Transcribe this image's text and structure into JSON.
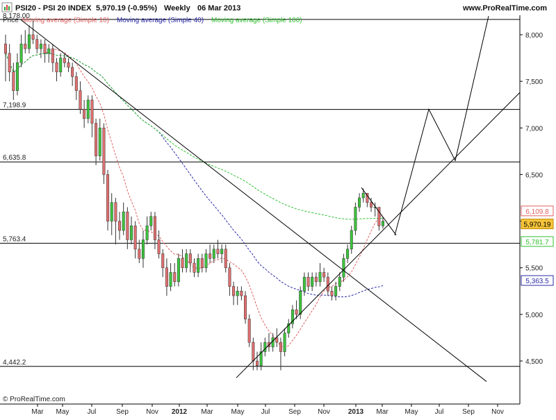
{
  "header": {
    "title": "PSI20 - PSI 20 INDEX",
    "quote": "5,970.19 (-0.95%)",
    "period": "Weekly",
    "date": "06 Mar 2013",
    "site": "www.ProRealTime.com"
  },
  "legend": {
    "price": "Price",
    "ma10": "Moving average (Simple 10)",
    "ma40": "Moving average (Simple 40)",
    "ma100": "Moving average (Simple 100)"
  },
  "copyright": "© ProRealTime.com",
  "colors": {
    "up": "#3cc43c",
    "down": "#e07070",
    "ma10": "#e06060",
    "ma40": "#2a2aa8",
    "ma100": "#30c030",
    "line": "#000000"
  },
  "chart_data": {
    "type": "candlestick",
    "x_ticks": [
      "Mar",
      "May",
      "Jul",
      "Sep",
      "Nov",
      "2012",
      "Mar",
      "May",
      "Jul",
      "Sep",
      "Nov",
      "2013",
      "Mar",
      "May",
      "Jul",
      "Sep",
      "Nov"
    ],
    "y_ticks": [
      "8,000",
      "7,500",
      "7,000",
      "6,500",
      "6,000",
      "5,500",
      "5,000",
      "4,500"
    ],
    "y_tick_values": [
      8000,
      7500,
      7000,
      6500,
      6000,
      5500,
      5000,
      4500
    ],
    "ylim": [
      4300,
      8200
    ],
    "horizontal_levels": [
      {
        "label": "7,198.9",
        "value": 7198.9
      },
      {
        "label": "6,635.8",
        "value": 6635.8
      },
      {
        "label": "5,763.4",
        "value": 5763.4
      },
      {
        "label": "4,442.2",
        "value": 4442.2
      }
    ],
    "top_level_label": "8,178.00",
    "price_tags": [
      {
        "label": "6,109.8",
        "value": 6109.8,
        "series": "ma10"
      },
      {
        "label": "5,970.19",
        "value": 5970.19,
        "series": "price"
      },
      {
        "label": "5,781.7",
        "value": 5781.7,
        "series": "ma100"
      },
      {
        "label": "5,363.5",
        "value": 5363.5,
        "series": "ma40"
      }
    ],
    "candles": [
      [
        7900,
        7800,
        8000,
        7500
      ],
      [
        7800,
        7600,
        7900,
        7500
      ],
      [
        7600,
        7400,
        7700,
        7300
      ],
      [
        7400,
        7700,
        7800,
        7350
      ],
      [
        7700,
        7900,
        8000,
        7650
      ],
      [
        7900,
        7850,
        8050,
        7800
      ],
      [
        7850,
        8000,
        8100,
        7800
      ],
      [
        8000,
        7950,
        8150,
        7900
      ],
      [
        7950,
        7850,
        8000,
        7800
      ],
      [
        7850,
        7900,
        7950,
        7750
      ],
      [
        7900,
        7800,
        7950,
        7700
      ],
      [
        7800,
        7850,
        7900,
        7700
      ],
      [
        7850,
        7700,
        7900,
        7600
      ],
      [
        7700,
        7600,
        7750,
        7500
      ],
      [
        7600,
        7750,
        7800,
        7550
      ],
      [
        7750,
        7700,
        7800,
        7650
      ],
      [
        7700,
        7650,
        7750,
        7600
      ],
      [
        7650,
        7550,
        7700,
        7450
      ],
      [
        7550,
        7400,
        7600,
        7300
      ],
      [
        7400,
        7200,
        7500,
        7150
      ],
      [
        7200,
        7100,
        7300,
        7000
      ],
      [
        7100,
        7300,
        7350,
        7050
      ],
      [
        7300,
        7050,
        7350,
        6900
      ],
      [
        7050,
        6700,
        7100,
        6600
      ],
      [
        6700,
        7000,
        7100,
        6650
      ],
      [
        7000,
        6500,
        7050,
        6400
      ],
      [
        6500,
        6000,
        6550,
        5900
      ],
      [
        6000,
        6200,
        6300,
        5850
      ],
      [
        6200,
        6000,
        6250,
        5750
      ],
      [
        6000,
        5900,
        6100,
        5800
      ],
      [
        5900,
        6100,
        6200,
        5850
      ],
      [
        6100,
        5800,
        6150,
        5700
      ],
      [
        5800,
        5950,
        6050,
        5750
      ],
      [
        5950,
        5700,
        6000,
        5600
      ],
      [
        5700,
        5600,
        5800,
        5550
      ],
      [
        5600,
        5800,
        5900,
        5500
      ],
      [
        5800,
        5950,
        6050,
        5750
      ],
      [
        5950,
        6050,
        6100,
        5900
      ],
      [
        6050,
        5800,
        6100,
        5700
      ],
      [
        5800,
        5650,
        5900,
        5600
      ],
      [
        5650,
        5500,
        5700,
        5400
      ],
      [
        5500,
        5300,
        5600,
        5200
      ],
      [
        5300,
        5450,
        5550,
        5250
      ],
      [
        5450,
        5350,
        5550,
        5300
      ],
      [
        5350,
        5600,
        5650,
        5300
      ],
      [
        5600,
        5500,
        5700,
        5450
      ],
      [
        5500,
        5650,
        5700,
        5450
      ],
      [
        5650,
        5550,
        5700,
        5450
      ],
      [
        5550,
        5450,
        5600,
        5400
      ],
      [
        5450,
        5600,
        5650,
        5400
      ],
      [
        5600,
        5500,
        5650,
        5450
      ],
      [
        5500,
        5650,
        5700,
        5450
      ],
      [
        5650,
        5600,
        5750,
        5550
      ],
      [
        5600,
        5700,
        5750,
        5550
      ],
      [
        5700,
        5650,
        5800,
        5600
      ],
      [
        5650,
        5700,
        5750,
        5550
      ],
      [
        5700,
        5500,
        5750,
        5450
      ],
      [
        5500,
        5300,
        5550,
        5200
      ],
      [
        5300,
        5200,
        5350,
        5100
      ],
      [
        5200,
        5250,
        5300,
        5100
      ],
      [
        5250,
        5200,
        5300,
        5150
      ],
      [
        5200,
        4950,
        5250,
        4900
      ],
      [
        4950,
        4700,
        5000,
        4650
      ],
      [
        4700,
        4500,
        4750,
        4400
      ],
      [
        4500,
        4450,
        4600,
        4400
      ],
      [
        4450,
        4600,
        4700,
        4400
      ],
      [
        4600,
        4700,
        4750,
        4550
      ],
      [
        4700,
        4650,
        4800,
        4600
      ],
      [
        4650,
        4750,
        4800,
        4600
      ],
      [
        4750,
        4700,
        4850,
        4650
      ],
      [
        4700,
        4600,
        4750,
        4400
      ],
      [
        4600,
        4800,
        4850,
        4550
      ],
      [
        4800,
        4900,
        4950,
        4750
      ],
      [
        4900,
        5050,
        5100,
        4850
      ],
      [
        5050,
        5000,
        5150,
        4950
      ],
      [
        5000,
        5250,
        5300,
        4950
      ],
      [
        5250,
        5400,
        5450,
        5200
      ],
      [
        5400,
        5300,
        5450,
        5250
      ],
      [
        5300,
        5400,
        5450,
        5250
      ],
      [
        5400,
        5350,
        5450,
        5300
      ],
      [
        5350,
        5450,
        5550,
        5300
      ],
      [
        5450,
        5400,
        5500,
        5350
      ],
      [
        5400,
        5250,
        5450,
        5200
      ],
      [
        5250,
        5200,
        5300,
        5150
      ],
      [
        5200,
        5300,
        5350,
        5150
      ],
      [
        5300,
        5400,
        5450,
        5250
      ],
      [
        5400,
        5600,
        5650,
        5350
      ],
      [
        5600,
        5700,
        5750,
        5550
      ],
      [
        5700,
        5900,
        5950,
        5650
      ],
      [
        5900,
        6150,
        6200,
        5850
      ],
      [
        6150,
        6250,
        6300,
        6100
      ],
      [
        6250,
        6300,
        6350,
        6200
      ],
      [
        6300,
        6200,
        6300,
        6150
      ],
      [
        6200,
        6150,
        6250,
        6100
      ],
      [
        6150,
        6150,
        6200,
        6050
      ],
      [
        6150,
        5950,
        6150,
        5900
      ],
      [
        5950,
        6000,
        6050,
        5920
      ]
    ],
    "annotations": [
      {
        "type": "trendline",
        "from": [
          "2011-02",
          8160
        ],
        "to": [
          "2013-10",
          4280
        ]
      },
      {
        "type": "trendline",
        "from": [
          "2012-05",
          4350
        ],
        "to": [
          "2013-11",
          7350
        ]
      },
      {
        "type": "projection",
        "points": [
          [
            "2013-03",
            5800
          ],
          [
            "2013-06",
            7200
          ],
          [
            "2013-08",
            6650
          ],
          [
            "2013-10",
            8200
          ]
        ]
      },
      {
        "type": "channel",
        "points": [
          [
            "2013-02",
            6360
          ],
          [
            "2013-03",
            5900
          ]
        ]
      }
    ]
  }
}
